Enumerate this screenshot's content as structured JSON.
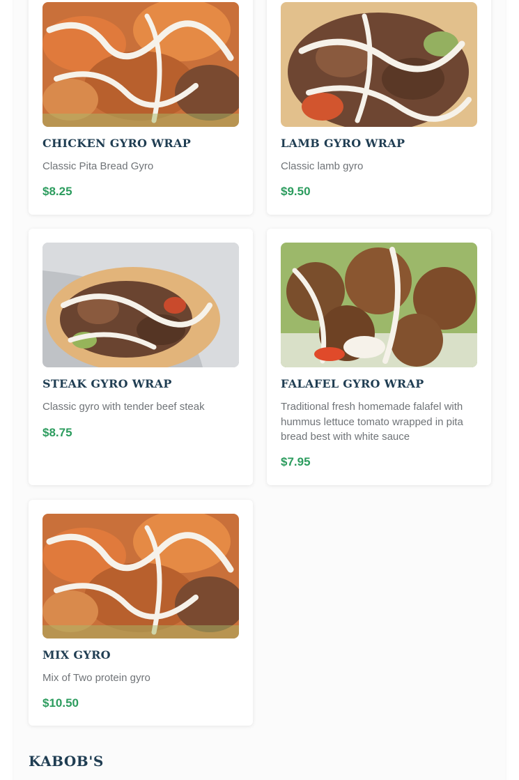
{
  "menu": {
    "items": [
      {
        "name": "CHICKEN GYRO WRAP",
        "description": "Classic Pita Bread Gyro",
        "price": "$8.25"
      },
      {
        "name": "LAMB GYRO WRAP",
        "description": "Classic lamb gyro",
        "price": "$9.50"
      },
      {
        "name": "STEAK GYRO WRAP",
        "description": "Classic gyro with tender beef steak",
        "price": "$8.75"
      },
      {
        "name": "FALAFEL GYRO WRAP",
        "description": "Traditional fresh homemade falafel with hummus lettuce tomato wrapped in pita bread best with white sauce",
        "price": "$7.95"
      },
      {
        "name": "MIX GYRO",
        "description": "Mix of Two protein gyro",
        "price": "$10.50"
      }
    ],
    "next_section_title": "KABOB'S"
  },
  "colors": {
    "title": "#1f3d52",
    "description": "#6f7377",
    "price": "#2c9c5e",
    "card_background": "#ffffff"
  }
}
